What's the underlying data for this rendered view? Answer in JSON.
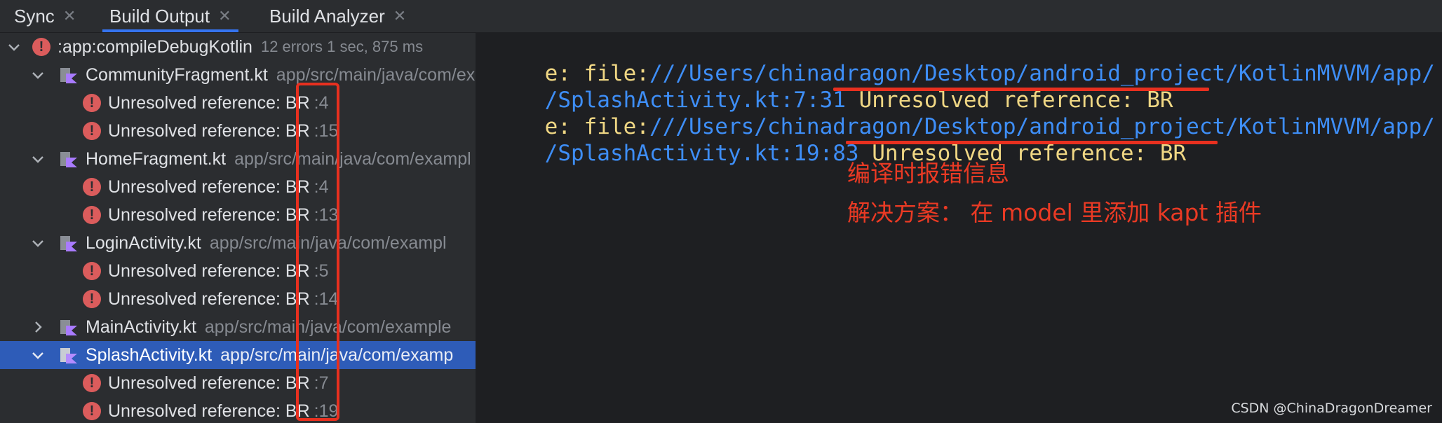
{
  "tabs": [
    {
      "label": "Sync"
    },
    {
      "label": "Build Output"
    },
    {
      "label": "Build Analyzer"
    }
  ],
  "tree": {
    "root": {
      "label": ":app:compileDebugKotlin",
      "summary": "12 errors 1 sec, 875 ms"
    },
    "files": [
      {
        "name": "CommunityFragment.kt",
        "path": "app/src/main/java/com/exampl",
        "errors": [
          {
            "text": "Unresolved reference: BR",
            "line": ":4"
          },
          {
            "text": "Unresolved reference: BR",
            "line": ":15"
          }
        ]
      },
      {
        "name": "HomeFragment.kt",
        "path": "app/src/main/java/com/exampl",
        "errors": [
          {
            "text": "Unresolved reference: BR",
            "line": ":4"
          },
          {
            "text": "Unresolved reference: BR",
            "line": ":13"
          }
        ]
      },
      {
        "name": "LoginActivity.kt",
        "path": "app/src/main/java/com/exampl",
        "errors": [
          {
            "text": "Unresolved reference: BR",
            "line": ":5"
          },
          {
            "text": "Unresolved reference: BR",
            "line": ":14"
          }
        ]
      },
      {
        "name": "MainActivity.kt",
        "path": "app/src/main/java/com/example"
      },
      {
        "name": "SplashActivity.kt",
        "path": "app/src/main/java/com/examp",
        "errors": [
          {
            "text": "Unresolved reference: BR",
            "line": ":7"
          },
          {
            "text": "Unresolved reference: BR",
            "line": ":19"
          }
        ]
      }
    ]
  },
  "console": {
    "line1_prefix": "e: file:",
    "line1_path": "///Users/chinadragon/Desktop/android_project/KotlinMVVM/app/",
    "line2_loc": "/SplashActivity.kt:7:31",
    "line2_msg": "Unresolved reference: BR",
    "line3_prefix": "e: file:",
    "line3_path": "///Users/chinadragon/Desktop/android_project/KotlinMVVM/app/",
    "line4_loc": "/SplashActivity.kt:19:83",
    "line4_msg": "Unresolved reference: BR"
  },
  "annotations": {
    "note1": "编译时报错信息",
    "note2": "解决方案： 在 model 里添加 kapt 插件"
  },
  "watermark": "CSDN @ChinaDragonDreamer",
  "colors": {
    "accent": "#3574f0",
    "error": "#db5c5c",
    "annotation": "#e8301f",
    "selection": "#2e5cb8"
  }
}
